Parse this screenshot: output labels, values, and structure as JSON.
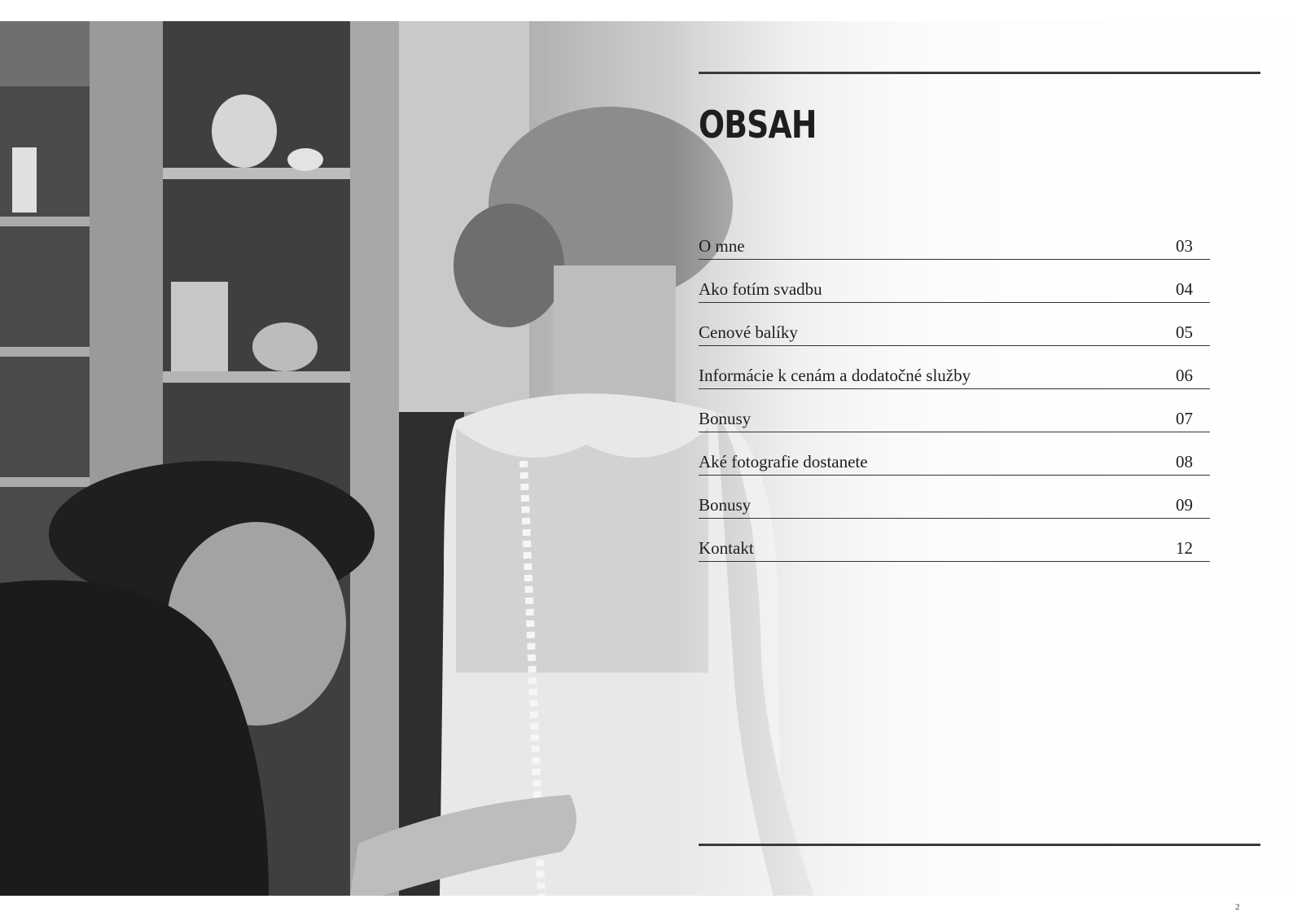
{
  "page": {
    "title": "OBSAH",
    "page_number": "2"
  },
  "toc": [
    {
      "label": "O mne",
      "page": "03"
    },
    {
      "label": "Ako fotím svadbu",
      "page": "04"
    },
    {
      "label": "Cenové balíky",
      "page": "05"
    },
    {
      "label": "Informácie k cenám a dodatočné služby",
      "page": "06"
    },
    {
      "label": "Bonusy",
      "page": "07"
    },
    {
      "label": "Aké fotografie dostanete",
      "page": "08"
    },
    {
      "label": "Bonusy",
      "page": "09"
    },
    {
      "label": "Kontakt",
      "page": "12"
    }
  ]
}
